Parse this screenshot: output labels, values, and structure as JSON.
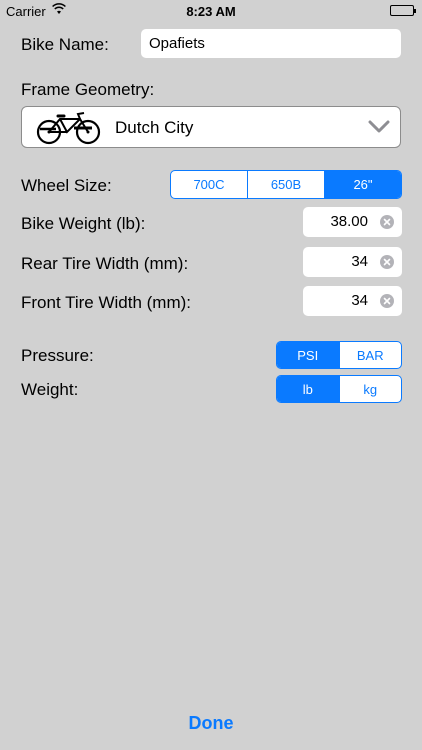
{
  "status_bar": {
    "carrier": "Carrier",
    "time": "8:23 AM"
  },
  "form": {
    "bike_name_label": "Bike Name:",
    "bike_name_value": "Opafiets",
    "frame_geometry_label": "Frame Geometry:",
    "frame_geometry_value": "Dutch City",
    "wheel_size_label": "Wheel Size:",
    "wheel_sizes": [
      "700C",
      "650B",
      "26\""
    ],
    "wheel_size_selected": "26\"",
    "bike_weight_label": "Bike Weight (lb):",
    "bike_weight_value": "38.00",
    "rear_tire_label": "Rear Tire Width (mm):",
    "rear_tire_value": "34",
    "front_tire_label": "Front Tire Width (mm):",
    "front_tire_value": "34",
    "pressure_label": "Pressure:",
    "pressure_units": [
      "PSI",
      "BAR"
    ],
    "pressure_selected": "PSI",
    "weight_label": "Weight:",
    "weight_units": [
      "lb",
      "kg"
    ],
    "weight_selected": "lb"
  },
  "done_label": "Done",
  "colors": {
    "accent": "#0a7aff",
    "background": "#d1d1d1"
  },
  "icons": {
    "bike": "bicycle-icon",
    "dropdown": "chevron-down-icon",
    "clear": "clear-icon"
  }
}
